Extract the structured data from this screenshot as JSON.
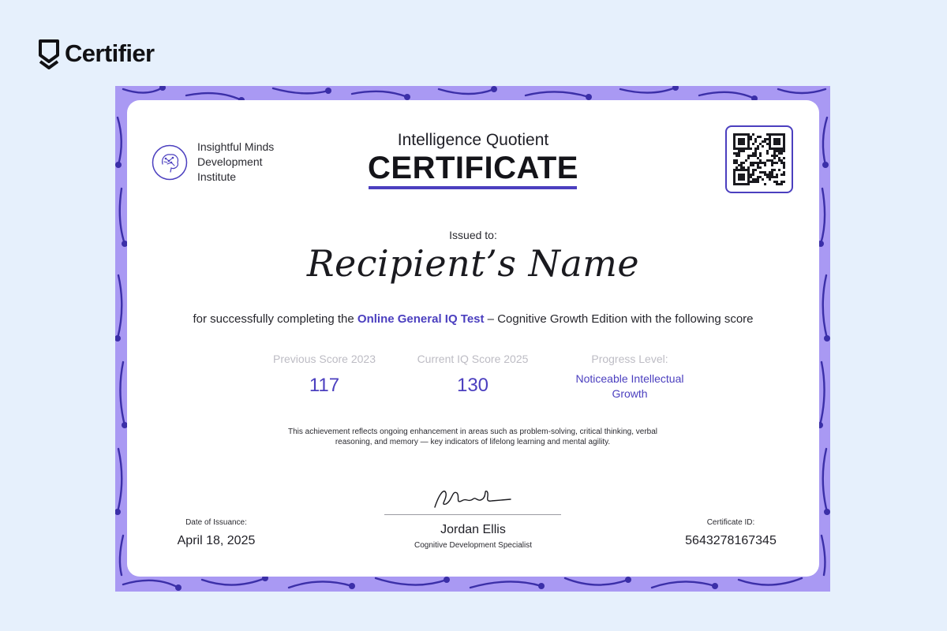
{
  "brand": {
    "name": "Certifier",
    "logo_icon": "certifier-shield-icon"
  },
  "colors": {
    "page_background": "#e6f0fc",
    "frame": "#a999f3",
    "accent": "#4b3fbf",
    "muted_label": "#bdbcc4"
  },
  "certificate": {
    "organization": {
      "line1": "Insightful Minds",
      "line2": "Development",
      "line3": "Institute",
      "emblem_icon": "brain-emblem-icon"
    },
    "heading_sub": "Intelligence Quotient",
    "heading_main": "CERTIFICATE",
    "qr_icon": "qr-code-icon",
    "issued_label": "Issued to:",
    "recipient_name": "Recipient’s Name",
    "statement": {
      "before": "for successfully completing the ",
      "highlight": "Online General IQ Test",
      "after": " – Cognitive Growth Edition with the following score"
    },
    "metrics": [
      {
        "label": "Previous Score 2023",
        "value": "117"
      },
      {
        "label": "Current IQ Score 2025",
        "value": "130"
      },
      {
        "label": "Progress Level:",
        "value_line1": "Noticeable Intellectual",
        "value_line2": "Growth"
      }
    ],
    "description_line1": "This achievement reflects ongoing enhancement in areas such as problem-solving, critical thinking, verbal",
    "description_line2": "reasoning, and memory — key indicators of lifelong learning and mental agility.",
    "signature": {
      "image_icon": "signature-icon",
      "name": "Jordan Ellis",
      "role": "Cognitive Development Specialist"
    },
    "date_label": "Date of Issuance:",
    "date_value": "April 18, 2025",
    "id_label": "Certificate ID:",
    "id_value": "5643278167345"
  }
}
